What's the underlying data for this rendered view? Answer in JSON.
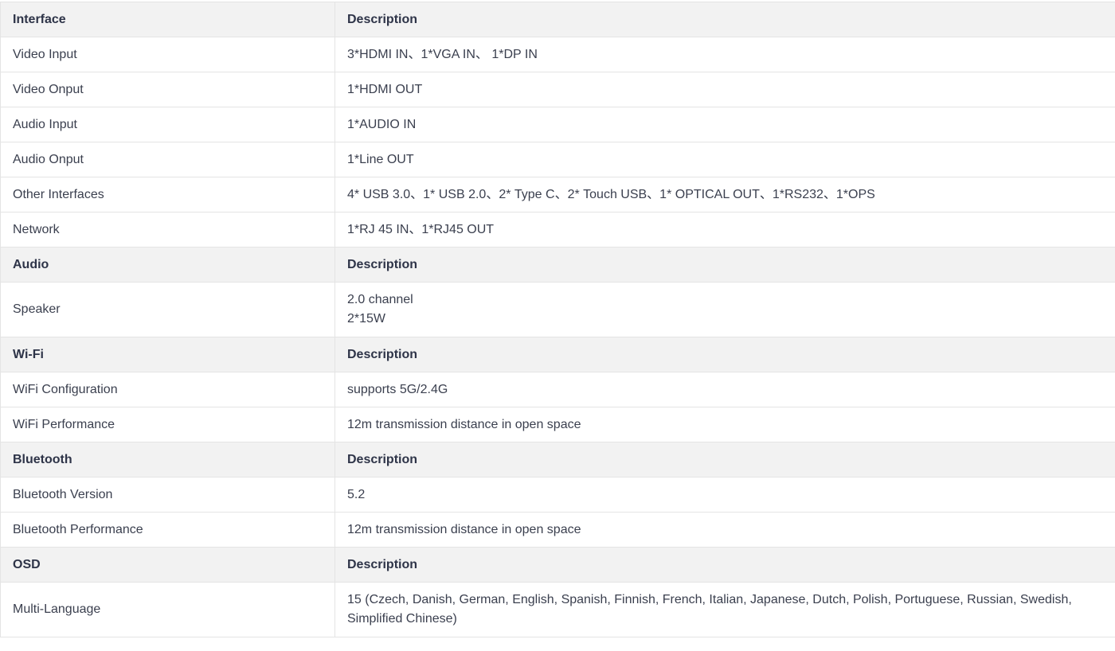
{
  "sections": [
    {
      "header": {
        "label": "Interface",
        "desc": "Description"
      },
      "rows": [
        {
          "label": "Video Input",
          "value": "3*HDMI IN、1*VGA IN、 1*DP IN"
        },
        {
          "label": "Video Onput",
          "value": "1*HDMI OUT"
        },
        {
          "label": "Audio Input",
          "value": "1*AUDIO IN"
        },
        {
          "label": "Audio Onput",
          "value": "1*Line OUT"
        },
        {
          "label": "Other Interfaces",
          "value": "4* USB 3.0、1* USB 2.0、2* Type C、2* Touch USB、1* OPTICAL OUT、1*RS232、1*OPS"
        },
        {
          "label": "Network",
          "value": "1*RJ 45 IN、1*RJ45 OUT"
        }
      ]
    },
    {
      "header": {
        "label": "Audio",
        "desc": "Description"
      },
      "rows": [
        {
          "label": "Speaker",
          "value_lines": [
            "2.0 channel",
            "2*15W"
          ]
        }
      ]
    },
    {
      "header": {
        "label": "Wi-Fi",
        "desc": "Description"
      },
      "rows": [
        {
          "label": "WiFi Configuration",
          "value": "supports 5G/2.4G"
        },
        {
          "label": "WiFi Performance",
          "value": "12m transmission distance in open space"
        }
      ]
    },
    {
      "header": {
        "label": "Bluetooth",
        "desc": "Description"
      },
      "rows": [
        {
          "label": "Bluetooth Version",
          "value": "5.2"
        },
        {
          "label": "Bluetooth Performance",
          "value": "12m transmission distance in open space"
        }
      ]
    },
    {
      "header": {
        "label": "OSD",
        "desc": "Description"
      },
      "rows": [
        {
          "label": "Multi-Language",
          "value_lines": [
            "15 (Czech, Danish, German, English, Spanish, Finnish, French, Italian, Japanese, Dutch, Polish, Portuguese, Russian, Swedish,",
            "Simplified Chinese)"
          ]
        }
      ]
    }
  ]
}
